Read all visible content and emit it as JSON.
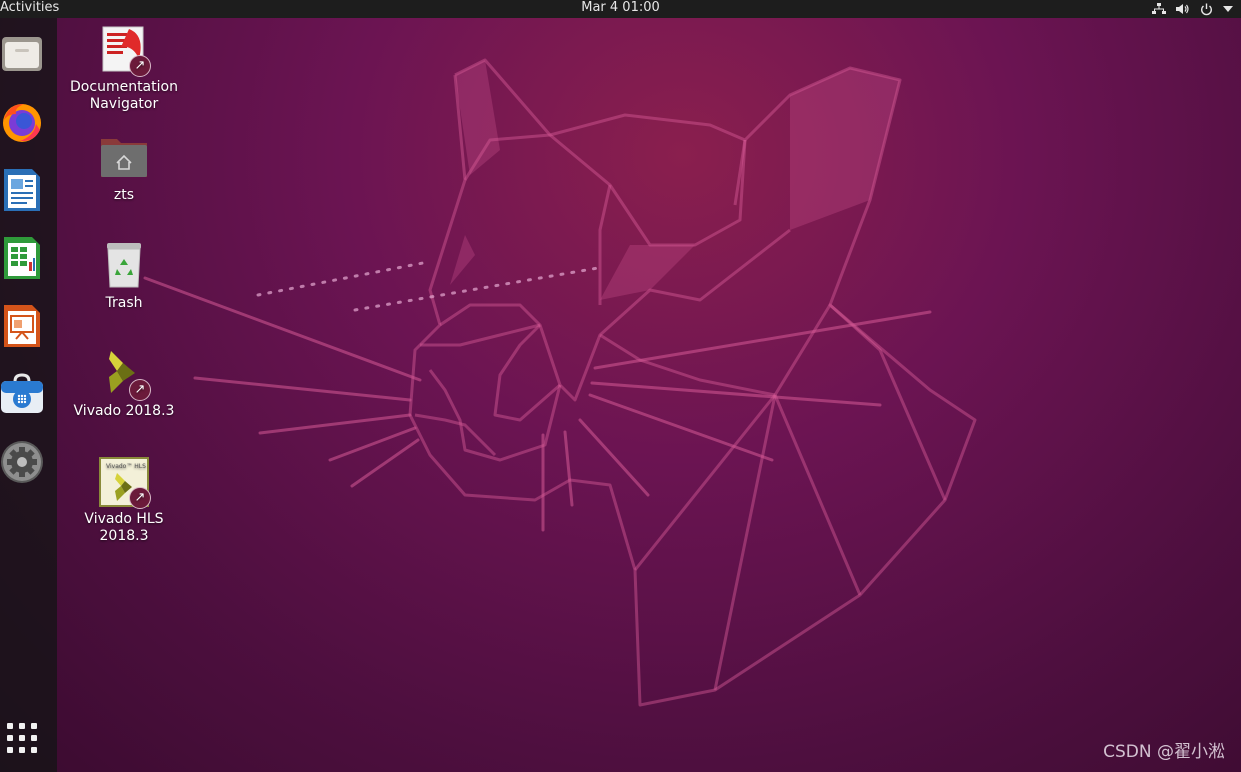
{
  "topbar": {
    "activities": "Activities",
    "clock": "Mar 4  01:00",
    "tray_icons": [
      "network-icon",
      "volume-icon",
      "power-icon",
      "dropdown-arrow-icon"
    ]
  },
  "dock": {
    "items": [
      {
        "name": "Files",
        "icon": "files-icon"
      },
      {
        "name": "Firefox",
        "icon": "firefox-icon"
      },
      {
        "name": "LibreOffice Writer",
        "icon": "writer-icon"
      },
      {
        "name": "LibreOffice Calc",
        "icon": "calc-icon"
      },
      {
        "name": "LibreOffice Impress",
        "icon": "impress-icon"
      },
      {
        "name": "Ubuntu Software",
        "icon": "software-store-icon"
      },
      {
        "name": "Settings",
        "icon": "settings-icon"
      }
    ],
    "show_apps_icon": "show-applications-icon"
  },
  "desktop": {
    "icons": [
      {
        "label": "Documentation\nNavigator",
        "icon": "documentation-navigator-icon",
        "shortcut": true
      },
      {
        "label": "zts",
        "icon": "home-folder-icon",
        "shortcut": false
      },
      {
        "label": "Trash",
        "icon": "trash-icon",
        "shortcut": false
      },
      {
        "label": "Vivado 2018.3",
        "icon": "vivado-icon",
        "shortcut": true
      },
      {
        "label": "Vivado HLS\n2018.3",
        "icon": "vivado-hls-icon",
        "shortcut": true,
        "inner_text": "Vivado™ HLS"
      }
    ]
  },
  "watermark": "CSDN @翟小淞",
  "colors": {
    "topbar": "#1d1d1d",
    "dock": "#141416",
    "wallpaper_top": "#8a1f4e",
    "wallpaper_bottom": "#3a0b2f",
    "accent": "#e95420"
  }
}
